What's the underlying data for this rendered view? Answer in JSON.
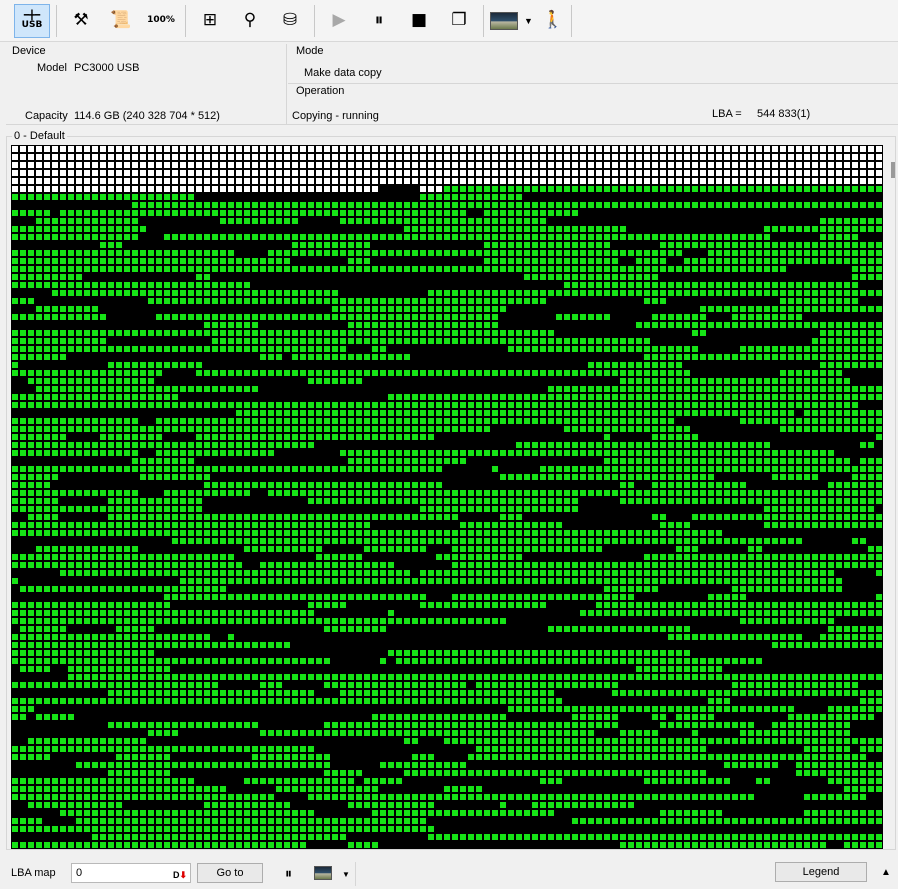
{
  "toolbar": {
    "buttons": [
      {
        "icon": "usb-connect-icon",
        "label": "USB",
        "active": true
      },
      {
        "icon": "tools-icon",
        "glyph": "⚒"
      },
      {
        "icon": "scroll-log-icon",
        "glyph": "📜"
      },
      {
        "icon": "percent-report-icon",
        "label": "100%"
      },
      {
        "icon": "tree-structure-icon",
        "glyph": "⊞"
      },
      {
        "icon": "binoculars-icon",
        "glyph": "⚲"
      },
      {
        "icon": "disk-image-icon",
        "glyph": "⛁"
      },
      {
        "icon": "play-icon",
        "glyph": "▶",
        "dim": true
      },
      {
        "icon": "pause-icon",
        "glyph": "⏸"
      },
      {
        "icon": "stop-icon",
        "glyph": "■"
      },
      {
        "icon": "windows-stack-icon",
        "glyph": "❐"
      },
      {
        "icon": "map-view-icon"
      },
      {
        "icon": "exit-door-icon",
        "glyph": "🚶"
      }
    ]
  },
  "device": {
    "group": "Device",
    "model_label": "Model",
    "model_value": "PC3000 USB",
    "capacity_label": "Capacity",
    "capacity_value": "114.6 GB (240 328 704 * 512)"
  },
  "mode": {
    "group": "Mode",
    "value": "Make data copy"
  },
  "operation": {
    "group": "Operation",
    "status": "Copying - running",
    "lba_label": "LBA =",
    "lba_value": "544 833(1)"
  },
  "map": {
    "title": "0 - Default",
    "colors": {
      "unread": "#ffffff",
      "copied": "#16e316",
      "bad": "#000000",
      "border": "#000000"
    }
  },
  "bottom": {
    "lba_map_label": "LBA map",
    "lba_input_value": "0",
    "goto_label": "Go to",
    "pause_glyph": "⏸",
    "legend_label": "Legend",
    "collapse_glyph": "▲",
    "dropdown_glyph": "▼"
  }
}
